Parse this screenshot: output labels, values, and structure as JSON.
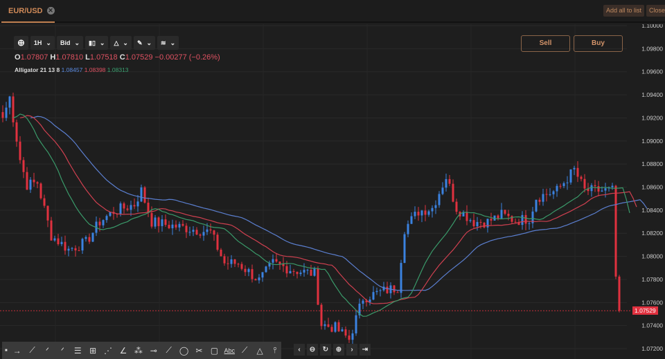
{
  "header": {
    "tab_label": "EUR/USD",
    "add_all_label": "Add all to list",
    "close_label": "Close"
  },
  "toolbar": {
    "timeframe": "1H",
    "price_type": "Bid"
  },
  "ohlc": {
    "o_label": "O",
    "o": "1.07807",
    "h_label": "H",
    "h": "1.07810",
    "l_label": "L",
    "l": "1.07518",
    "c_label": "C",
    "c": "1.07529",
    "change": "−0.00277 (−0.26%)"
  },
  "indicator": {
    "name": "Alligator 21 13 8",
    "jaw": "1.08457",
    "teeth": "1.08398",
    "lips": "1.08313"
  },
  "trade": {
    "sell_label": "Sell",
    "buy_label": "Buy"
  },
  "colors": {
    "up": "#3b82e0",
    "down": "#e0313f",
    "jaw": "#5b7fd0",
    "teeth": "#d04050",
    "lips": "#3a9a6a",
    "accent": "#d08a58"
  },
  "chart_data": {
    "type": "candlestick",
    "y_ticks": [
      "1.10000",
      "1.09800",
      "1.09600",
      "1.09400",
      "1.09200",
      "1.09000",
      "1.08800",
      "1.08600",
      "1.08400",
      "1.08200",
      "1.08000",
      "1.07800",
      "1.07600",
      "1.07400",
      "1.07200"
    ],
    "ylim": [
      1.072,
      1.1
    ],
    "last_price": "1.07529",
    "close_path": [
      [
        0,
        1.092
      ],
      [
        2,
        1.0938
      ],
      [
        5,
        1.0884
      ],
      [
        7,
        1.0862
      ],
      [
        10,
        1.0864
      ],
      [
        14,
        1.0818
      ],
      [
        19,
        1.0806
      ],
      [
        24,
        1.0812
      ],
      [
        28,
        1.083
      ],
      [
        32,
        1.0839
      ],
      [
        38,
        1.0845
      ],
      [
        40,
        1.0857
      ],
      [
        43,
        1.083
      ],
      [
        48,
        1.0827
      ],
      [
        54,
        1.0824
      ],
      [
        60,
        1.0821
      ],
      [
        64,
        1.0794
      ],
      [
        68,
        1.0794
      ],
      [
        74,
        1.0779
      ],
      [
        78,
        1.0794
      ],
      [
        84,
        1.0788
      ],
      [
        90,
        1.0785
      ],
      [
        92,
        1.0741
      ],
      [
        96,
        1.0738
      ],
      [
        100,
        1.0728
      ],
      [
        104,
        1.0764
      ],
      [
        110,
        1.077
      ],
      [
        114,
        1.0773
      ],
      [
        116,
        1.0824
      ],
      [
        120,
        1.0839
      ],
      [
        124,
        1.0842
      ],
      [
        128,
        1.0869
      ],
      [
        131,
        1.0842
      ],
      [
        136,
        1.083
      ],
      [
        140,
        1.083
      ],
      [
        144,
        1.0836
      ],
      [
        148,
        1.0831
      ],
      [
        152,
        1.0833
      ],
      [
        154,
        1.0851
      ],
      [
        160,
        1.0857
      ],
      [
        165,
        1.0875
      ],
      [
        168,
        1.0857
      ],
      [
        176,
        1.0857
      ],
      [
        177,
        1.0782
      ],
      [
        178,
        1.07529
      ]
    ]
  }
}
